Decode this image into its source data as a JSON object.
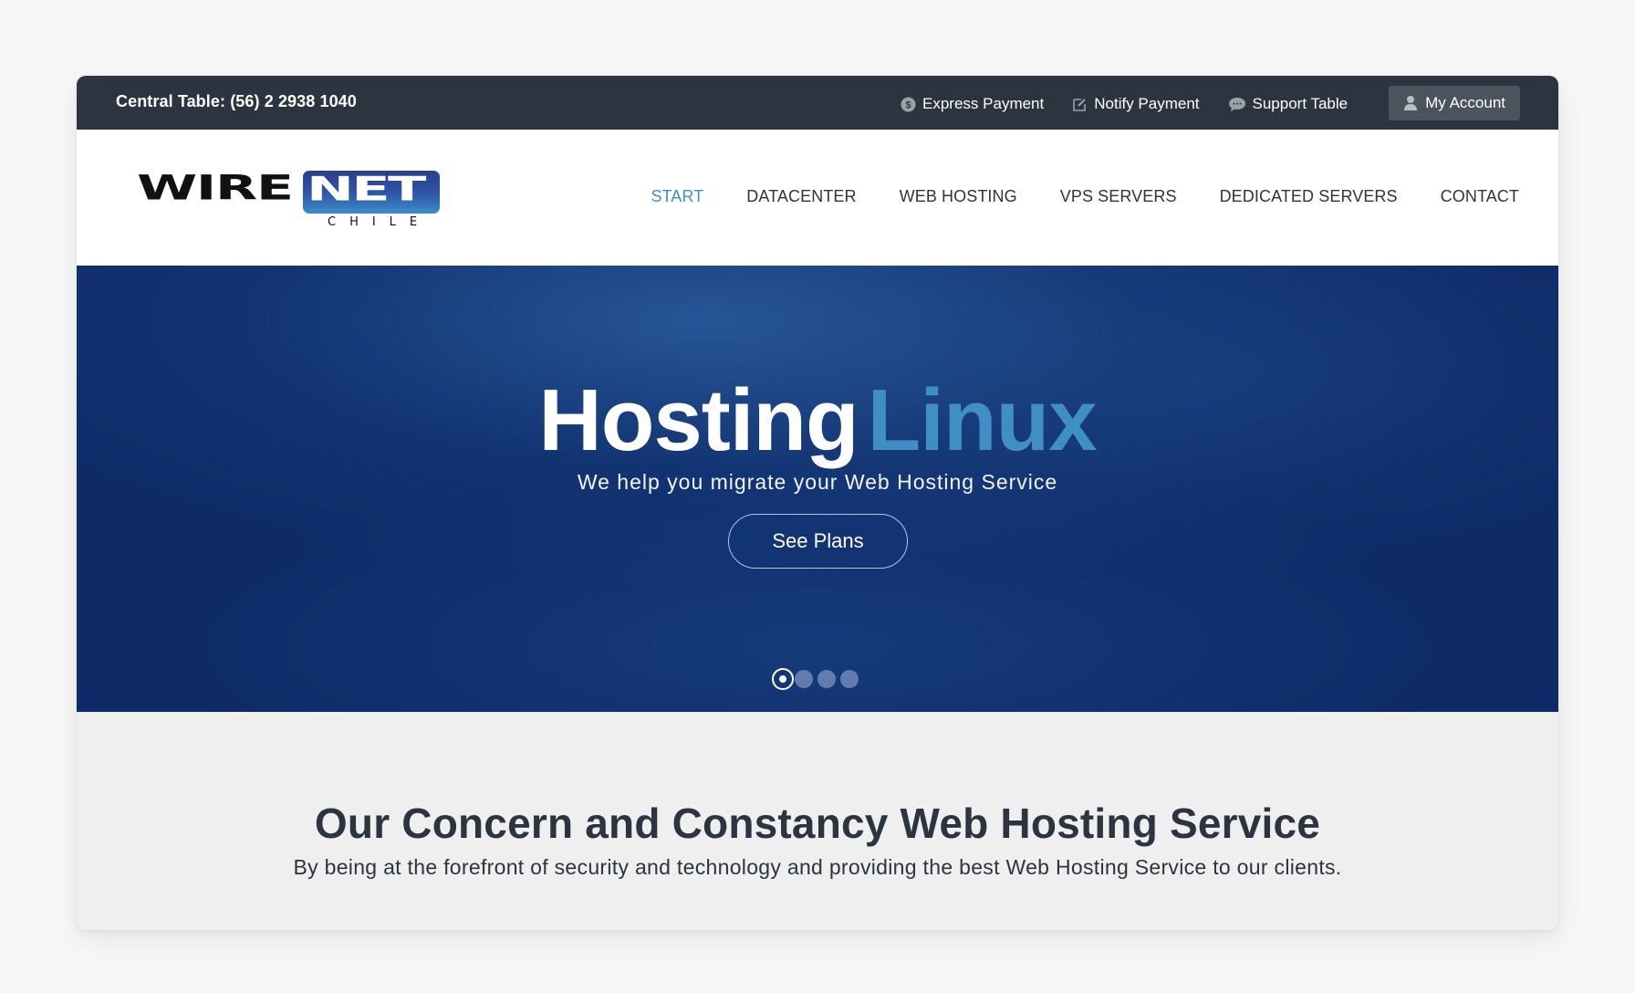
{
  "topbar": {
    "phone": "Central Table: (56) 2 2938 1040",
    "links": [
      {
        "label": "Express Payment",
        "icon": "dollar-circle-icon"
      },
      {
        "label": "Notify Payment",
        "icon": "edit-icon"
      },
      {
        "label": "Support Table",
        "icon": "chat-bubble-icon"
      }
    ],
    "account": {
      "label": "My Account",
      "icon": "user-icon"
    }
  },
  "header": {
    "logo": {
      "wire": "WIRE",
      "net": "NET",
      "sub": "CHILE"
    },
    "nav": [
      {
        "label": "START",
        "active": true
      },
      {
        "label": "DATACENTER",
        "active": false
      },
      {
        "label": "WEB HOSTING",
        "active": false
      },
      {
        "label": "VPS SERVERS",
        "active": false
      },
      {
        "label": "DEDICATED SERVERS",
        "active": false
      },
      {
        "label": "CONTACT",
        "active": false
      }
    ]
  },
  "hero": {
    "title_main": "Hosting",
    "title_accent": "Linux",
    "subtitle": "We help you migrate your Web Hosting Service",
    "cta": "See Plans",
    "slides_total": 4,
    "slide_active": 1
  },
  "about": {
    "title": "Our Concern and Constancy Web Hosting Service",
    "text": "By being at the forefront of security and technology and providing the best Web Hosting Service to our clients."
  },
  "colors": {
    "topbar_bg": "#2c353f",
    "accent": "#3f8fc6",
    "hero_bg": "#0d2a66",
    "account_bg": "#4b535c",
    "text_dark": "#2c353f"
  }
}
